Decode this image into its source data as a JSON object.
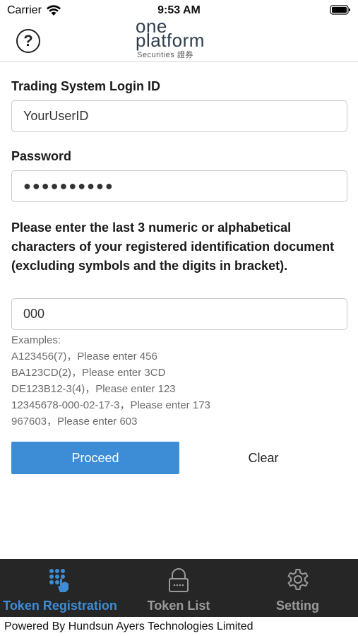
{
  "status_bar": {
    "carrier": "Carrier",
    "time": "9:53 AM"
  },
  "header": {
    "help_symbol": "?",
    "logo": {
      "line1": "one",
      "line2": "platform",
      "subtitle": "Securities 證券"
    }
  },
  "form": {
    "login_id": {
      "label": "Trading System Login ID",
      "value": "YourUserID"
    },
    "password": {
      "label": "Password",
      "value": "●●●●●●●●●●"
    },
    "id_chars": {
      "instruction": "Please enter the last 3 numeric or alphabetical characters of your registered identification document (excluding symbols and the digits in bracket).",
      "value": "000"
    },
    "examples": [
      "Examples:",
      "A123456(7)，Please enter 456",
      "BA123CD(2)，Please enter 3CD",
      "DE123B12-3(4)，Please enter 123",
      "12345678-000-02-17-3，Please enter 173",
      "967603，Please enter 603"
    ],
    "proceed_label": "Proceed",
    "clear_label": "Clear"
  },
  "tabbar": {
    "tabs": [
      {
        "label": "Token Registration",
        "icon": "token-registration-icon",
        "active": true
      },
      {
        "label": "Token List",
        "icon": "lock-icon",
        "active": false
      },
      {
        "label": "Setting",
        "icon": "gear-icon",
        "active": false
      }
    ]
  },
  "footer": {
    "text": "Powered By Hundsun Ayers Technologies Limited"
  },
  "colors": {
    "accent": "#3d8dd6",
    "tabbar_bg": "#262626",
    "tab_inactive": "#9a9a9a"
  }
}
